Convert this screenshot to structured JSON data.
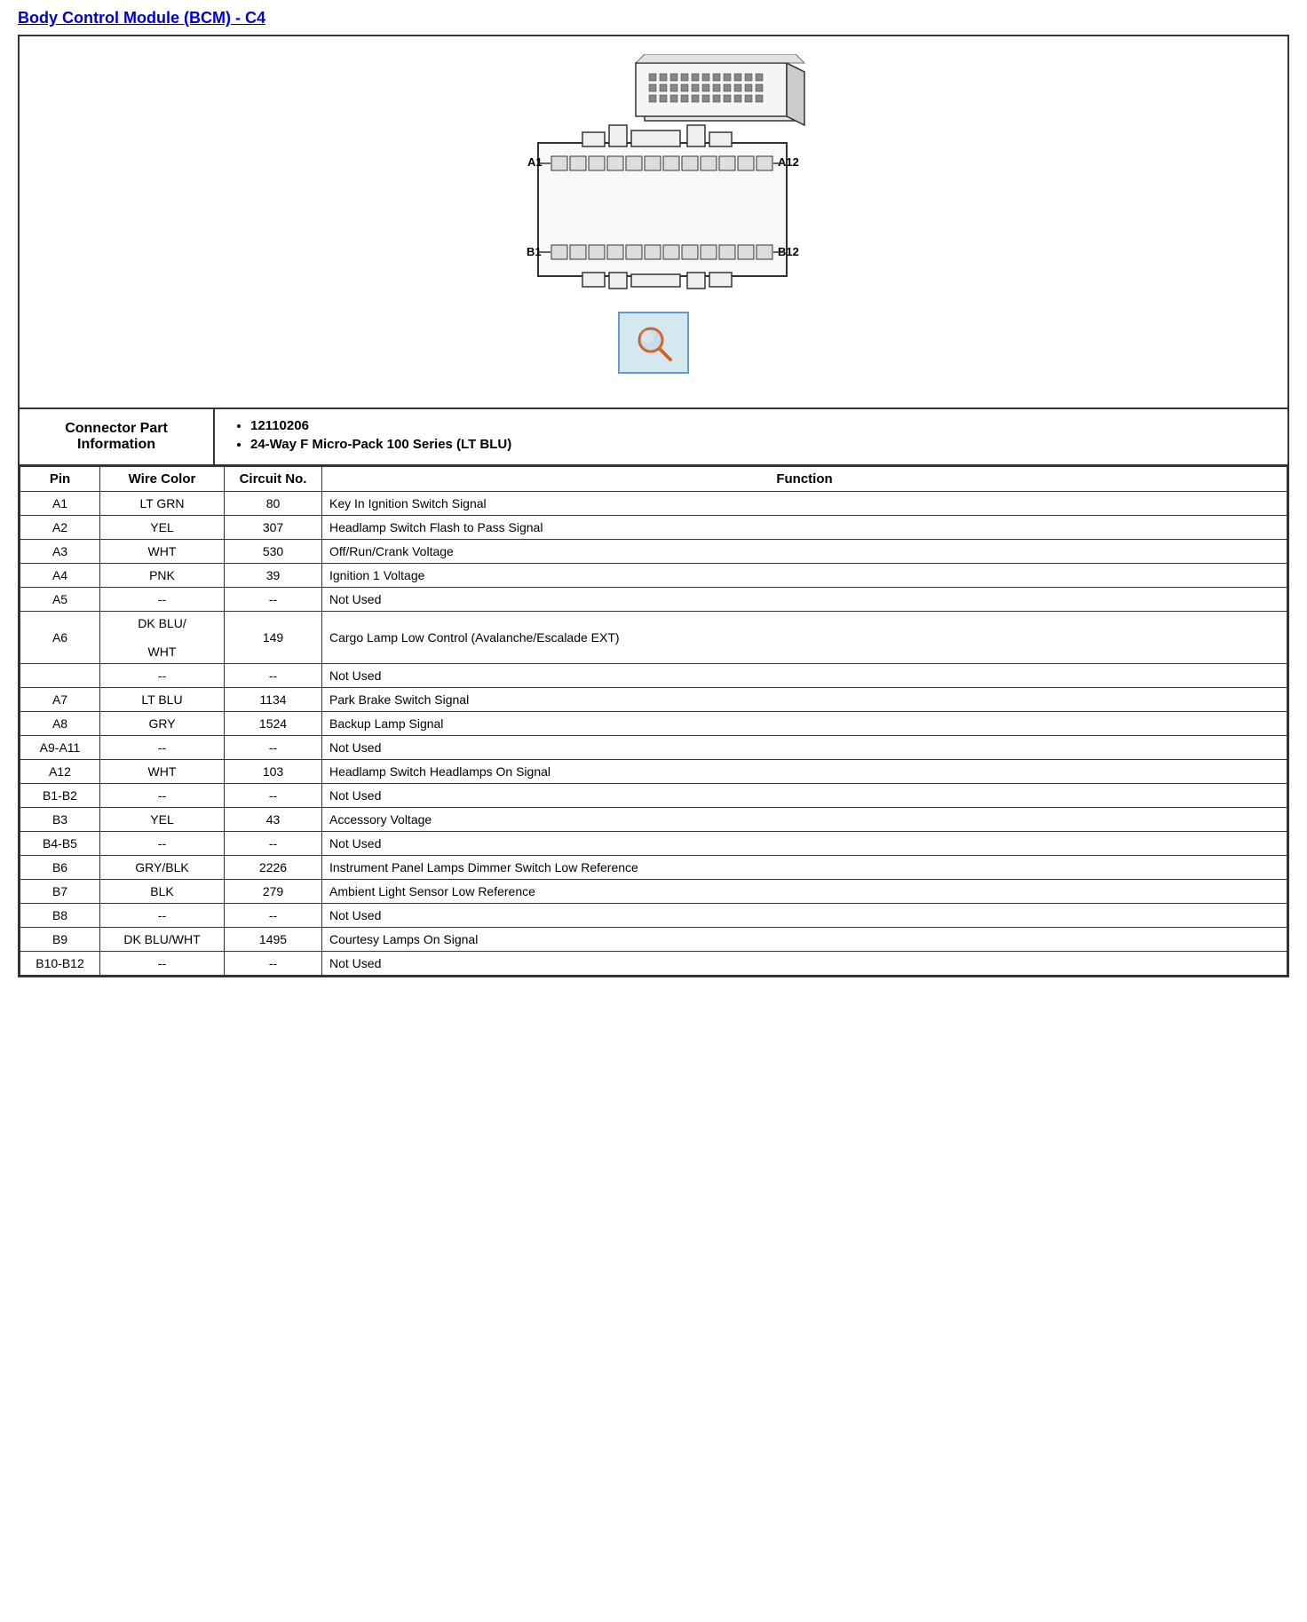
{
  "title": "Body Control Module (BCM) - C4",
  "connector_part_label": "Connector Part Information",
  "connector_part_details": [
    "12110206",
    "24-Way F Micro-Pack 100 Series (LT BLU)"
  ],
  "table_headers": {
    "pin": "Pin",
    "wire_color": "Wire Color",
    "circuit_no": "Circuit No.",
    "function": "Function"
  },
  "pins": [
    {
      "pin": "A1",
      "wire_color": "LT GRN",
      "circuit_no": "80",
      "function": "Key In Ignition Switch Signal"
    },
    {
      "pin": "A2",
      "wire_color": "YEL",
      "circuit_no": "307",
      "function": "Headlamp Switch Flash to Pass Signal"
    },
    {
      "pin": "A3",
      "wire_color": "WHT",
      "circuit_no": "530",
      "function": "Off/Run/Crank Voltage"
    },
    {
      "pin": "A4",
      "wire_color": "PNK",
      "circuit_no": "39",
      "function": "Ignition 1 Voltage"
    },
    {
      "pin": "A5",
      "wire_color": "--",
      "circuit_no": "--",
      "function": "Not Used"
    },
    {
      "pin": "A6",
      "wire_color": "DK BLU/\n\nWHT",
      "circuit_no": "149",
      "function": "Cargo Lamp Low Control (Avalanche/Escalade EXT)"
    },
    {
      "pin": "",
      "wire_color": "--",
      "circuit_no": "--",
      "function": "Not Used"
    },
    {
      "pin": "A7",
      "wire_color": "LT BLU",
      "circuit_no": "1134",
      "function": "Park Brake Switch Signal"
    },
    {
      "pin": "A8",
      "wire_color": "GRY",
      "circuit_no": "1524",
      "function": "Backup Lamp Signal"
    },
    {
      "pin": "A9-A11",
      "wire_color": "--",
      "circuit_no": "--",
      "function": "Not Used"
    },
    {
      "pin": "A12",
      "wire_color": "WHT",
      "circuit_no": "103",
      "function": "Headlamp Switch Headlamps On Signal"
    },
    {
      "pin": "B1-B2",
      "wire_color": "--",
      "circuit_no": "--",
      "function": "Not Used"
    },
    {
      "pin": "B3",
      "wire_color": "YEL",
      "circuit_no": "43",
      "function": "Accessory Voltage"
    },
    {
      "pin": "B4-B5",
      "wire_color": "--",
      "circuit_no": "--",
      "function": "Not Used"
    },
    {
      "pin": "B6",
      "wire_color": "GRY/BLK",
      "circuit_no": "2226",
      "function": "Instrument Panel Lamps Dimmer Switch Low Reference"
    },
    {
      "pin": "B7",
      "wire_color": "BLK",
      "circuit_no": "279",
      "function": "Ambient Light Sensor Low Reference"
    },
    {
      "pin": "B8",
      "wire_color": "--",
      "circuit_no": "--",
      "function": "Not Used"
    },
    {
      "pin": "B9",
      "wire_color": "DK BLU/WHT",
      "circuit_no": "1495",
      "function": "Courtesy Lamps On Signal"
    },
    {
      "pin": "B10-B12",
      "wire_color": "--",
      "circuit_no": "--",
      "function": "Not Used"
    }
  ]
}
